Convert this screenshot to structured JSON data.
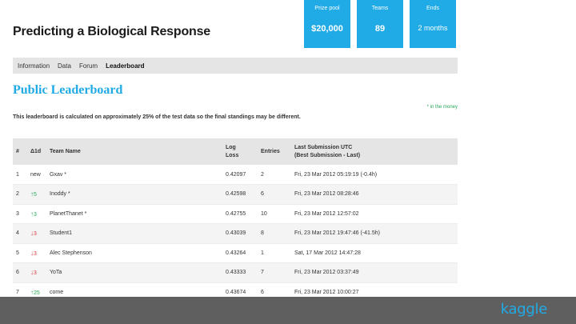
{
  "stats": [
    {
      "label": "Prize pool",
      "value": "$20,000"
    },
    {
      "label": "Teams",
      "value": "89"
    },
    {
      "label": "Ends",
      "value": "2 months"
    }
  ],
  "competition_title": "Predicting a Biological Response",
  "tabs": [
    "Information",
    "Data",
    "Forum",
    "Leaderboard"
  ],
  "leaderboard_title": "Public Leaderboard",
  "money_note": "* in the money",
  "notice": "This leaderboard is calculated on approximately 25% of the test data so the final standings may be different.",
  "columns": {
    "rank": "#",
    "delta": "Δ1d",
    "team": "Team Name",
    "loss_line1": "Log",
    "loss_line2": "Loss",
    "entries": "Entries",
    "sub_line1": "Last Submission UTC",
    "sub_line2": "(Best Submission - Last)"
  },
  "rows": [
    {
      "rank": "1",
      "delta": "new",
      "dir": "",
      "team": "Gxav *",
      "loss": "0.42097",
      "entries": "2",
      "submission": "Fri, 23 Mar 2012 05:19:19 (-0.4h)"
    },
    {
      "rank": "2",
      "delta": "5",
      "dir": "up",
      "team": "Inoddy *",
      "loss": "0.42598",
      "entries": "6",
      "submission": "Fri, 23 Mar 2012 08:28:46"
    },
    {
      "rank": "3",
      "delta": "3",
      "dir": "up",
      "team": "PlanetThanet *",
      "loss": "0.42755",
      "entries": "10",
      "submission": "Fri, 23 Mar 2012 12:57:02"
    },
    {
      "rank": "4",
      "delta": "3",
      "dir": "down",
      "team": "Student1",
      "loss": "0.43039",
      "entries": "8",
      "submission": "Fri, 23 Mar 2012 19:47:46 (-41.5h)"
    },
    {
      "rank": "5",
      "delta": "3",
      "dir": "down",
      "team": "Alec Stephenson",
      "loss": "0.43264",
      "entries": "1",
      "submission": "Sat, 17 Mar 2012 14:47:28"
    },
    {
      "rank": "6",
      "delta": "3",
      "dir": "down",
      "team": "YoTa",
      "loss": "0.43333",
      "entries": "7",
      "submission": "Fri, 23 Mar 2012 03:37:49"
    },
    {
      "rank": "7",
      "delta": "25",
      "dir": "up",
      "team": "come",
      "loss": "0.43674",
      "entries": "6",
      "submission": "Fri, 23 Mar 2012 10:00:27"
    }
  ],
  "brand": "kaggle",
  "colors": {
    "accent": "#20aae6",
    "up": "#2aa95b",
    "down": "#d83a3a",
    "footer": "#5f5f5f"
  }
}
